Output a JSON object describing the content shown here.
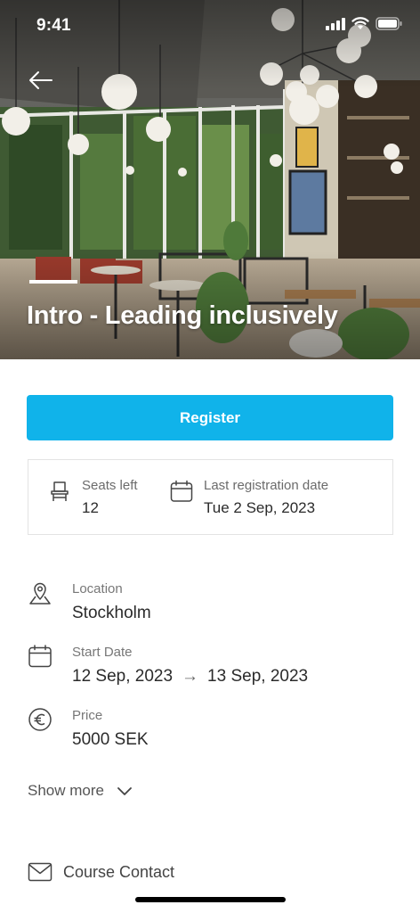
{
  "status_bar": {
    "time": "9:41"
  },
  "hero": {
    "title": "Intro - Leading inclusively"
  },
  "register_label": "Register",
  "info_card": {
    "seats": {
      "label": "Seats left",
      "value": "12"
    },
    "deadline": {
      "label": "Last registration date",
      "value": "Tue 2 Sep, 2023"
    }
  },
  "details": {
    "location": {
      "label": "Location",
      "value": "Stockholm"
    },
    "start_date": {
      "label": "Start Date",
      "from": "12 Sep, 2023",
      "arrow": "→",
      "to": "13 Sep, 2023"
    },
    "price": {
      "label": "Price",
      "value": "5000 SEK"
    }
  },
  "show_more_label": "Show more",
  "course_contact_label": "Course Contact",
  "colors": {
    "accent": "#10b3ea",
    "text": "#2b2b2b",
    "muted": "#777777",
    "border": "#e3e3e3"
  },
  "icons": [
    "arrow-left-icon",
    "signal-icon",
    "wifi-icon",
    "battery-icon",
    "chair-icon",
    "calendar-icon",
    "location-pin-icon",
    "euro-icon",
    "chevron-down-icon",
    "mail-icon"
  ]
}
